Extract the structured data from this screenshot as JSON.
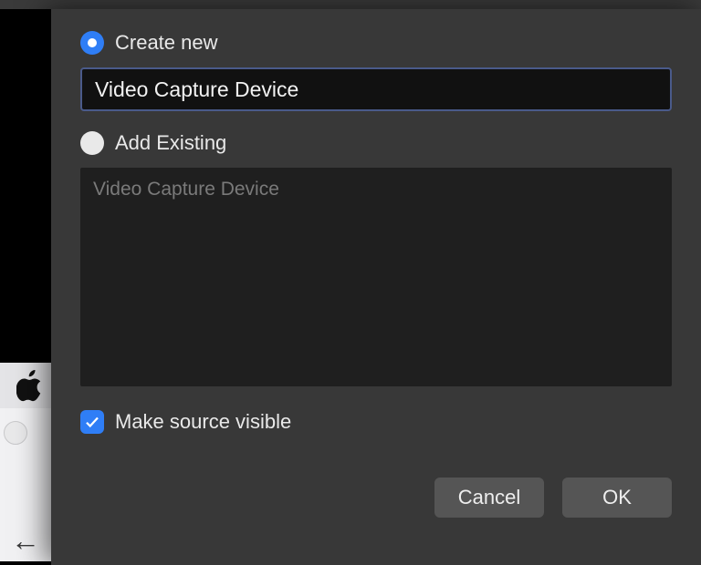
{
  "dialog": {
    "create_new_label": "Create new",
    "name_value": "Video Capture Device",
    "add_existing_label": "Add Existing",
    "existing_items": [
      "Video Capture Device"
    ],
    "make_visible_label": "Make source visible",
    "make_visible_checked": true,
    "selected_mode": "create_new",
    "cancel_label": "Cancel",
    "ok_label": "OK"
  }
}
